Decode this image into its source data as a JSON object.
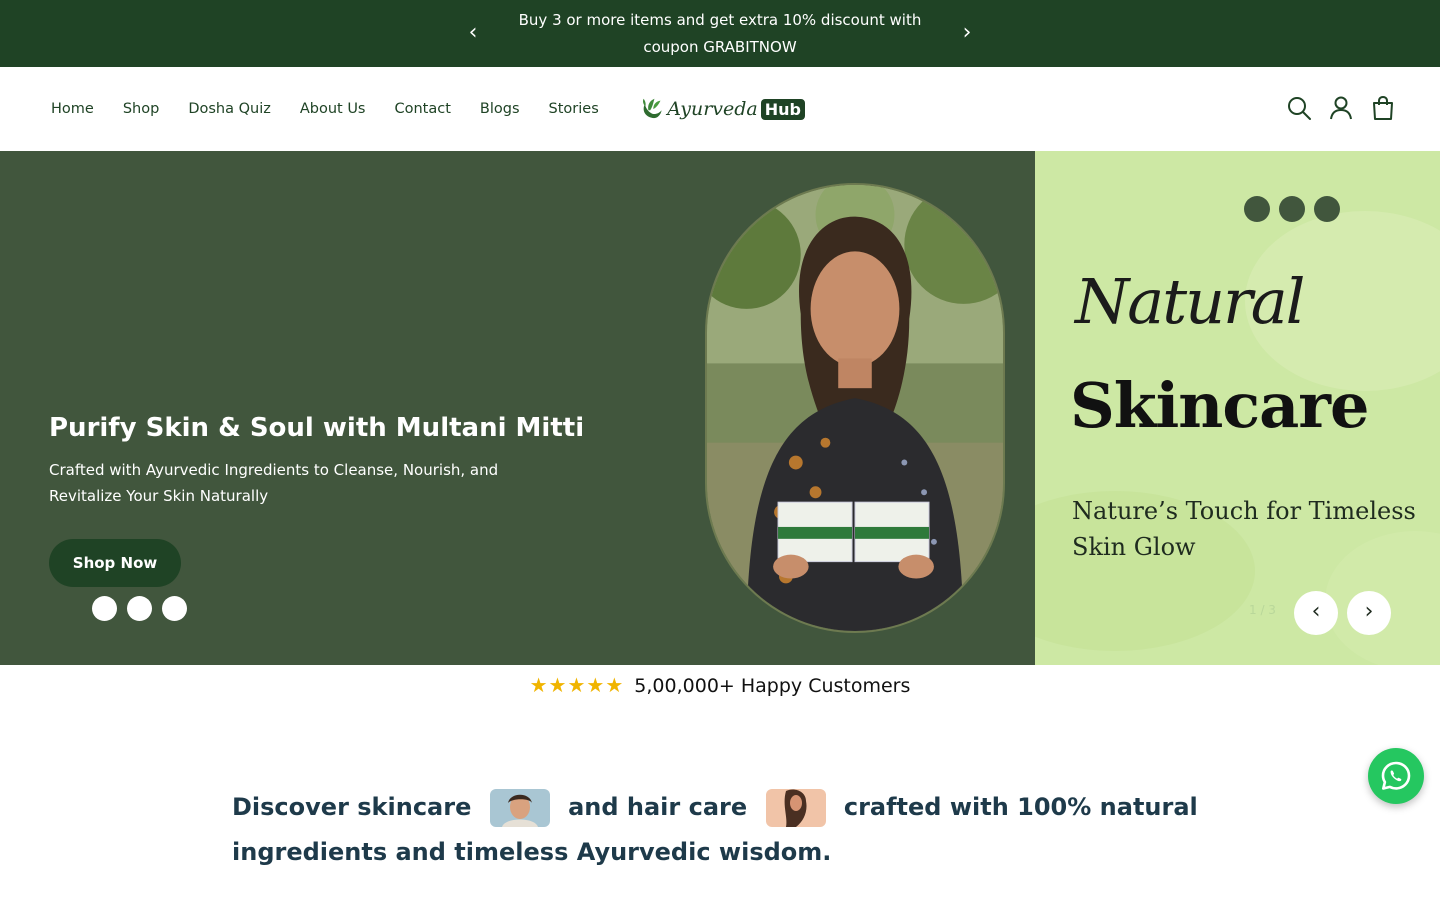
{
  "announcement": {
    "message": "Buy 3 or more items and get extra 10% discount with coupon GRABITNOW",
    "prev_icon": "chevron-left-icon",
    "next_icon": "chevron-right-icon"
  },
  "header": {
    "nav": [
      "Home",
      "Shop",
      "Dosha Quiz",
      "About Us",
      "Contact",
      "Blogs",
      "Stories"
    ],
    "logo": {
      "text": "Ayurveda",
      "badge": "Hub"
    },
    "icons": [
      "search-icon",
      "account-icon",
      "cart-icon"
    ]
  },
  "hero": {
    "title": "Purify Skin & Soul with Multani Mitti",
    "subtitle": "Crafted with Ayurvedic Ingredients to Cleanse, Nourish, and Revitalize Your Skin Naturally",
    "cta": "Shop Now"
  },
  "banner": {
    "script": "Natural",
    "headline": "Skincare",
    "tagline": "Nature’s Touch for Timeless Skin Glow",
    "counter": "1 / 3"
  },
  "rating": {
    "stars": "★★★★★",
    "text": "5,00,000+ Happy Customers"
  },
  "discover": {
    "part1": "Discover skincare",
    "part2": "and hair care",
    "part3": "crafted with 100% natural ingredients and timeless Ayurvedic wisdom."
  },
  "colors": {
    "announce_bg": "#1f4325",
    "hero_bg": "#41563d",
    "banner_bg": "#cde8a4",
    "whatsapp": "#25c760",
    "stars": "#f0b400"
  }
}
